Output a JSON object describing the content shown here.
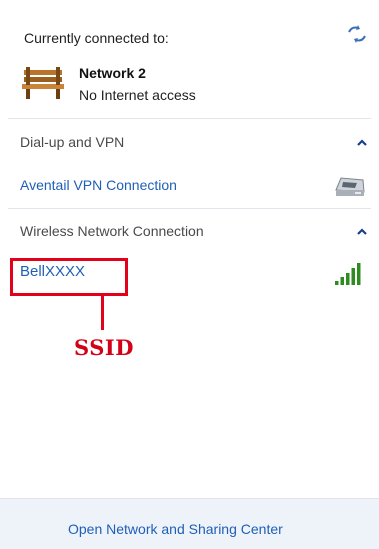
{
  "status": {
    "heading": "Currently connected to:",
    "network_name": "Network  2",
    "network_status": "No Internet access"
  },
  "sections": {
    "dialup": {
      "label": "Dial-up and VPN",
      "items": [
        {
          "label": "Aventail VPN Connection"
        }
      ]
    },
    "wireless": {
      "label": "Wireless Network Connection",
      "items": [
        {
          "label": "BellXXXX",
          "signal": 5
        }
      ]
    }
  },
  "annotation": {
    "label": "SSID",
    "color": "#e3001b"
  },
  "footer": {
    "link_label": "Open Network and Sharing Center"
  },
  "colors": {
    "link": "#1f5fb8",
    "accent_signal": "#2e8b1f",
    "footer_bg": "#eef3f9"
  },
  "icons": [
    "refresh-icon",
    "bench-network-icon",
    "collapse-icon",
    "vpn-modem-icon",
    "signal-strength-icon"
  ]
}
